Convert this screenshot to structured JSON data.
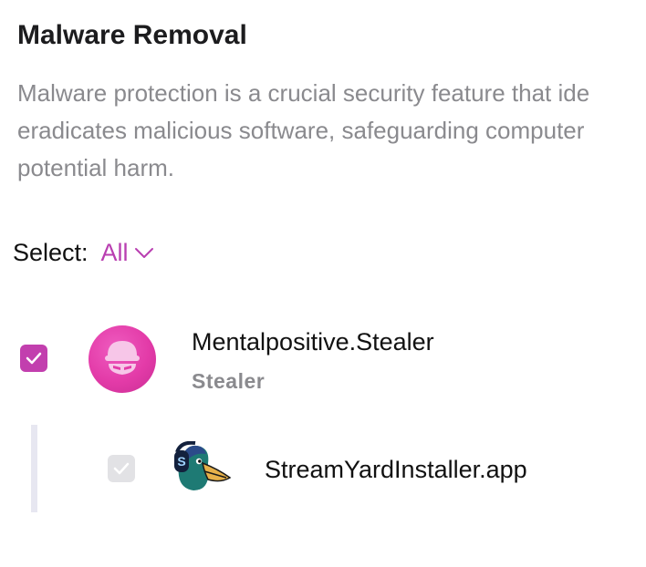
{
  "header": {
    "title": "Malware Removal",
    "description_lines": [
      "Malware protection is a crucial security feature that ide",
      "eradicates malicious software, safeguarding computer",
      "potential harm."
    ]
  },
  "select": {
    "label": "Select:",
    "value": "All"
  },
  "threats": [
    {
      "name": "Mentalpositive.Stealer",
      "type": "Stealer",
      "checked": true,
      "icon": "hooded-thief-icon",
      "items": [
        {
          "name": "StreamYardInstaller.app",
          "checked": true,
          "disabled": true,
          "icon": "duck-headphones-app-icon"
        }
      ]
    }
  ],
  "colors": {
    "accent": "#b93fb1",
    "checkbox_checked": "#c23fae",
    "checkbox_disabled": "#e2e2e5",
    "muted_text": "#8a8a8e"
  }
}
